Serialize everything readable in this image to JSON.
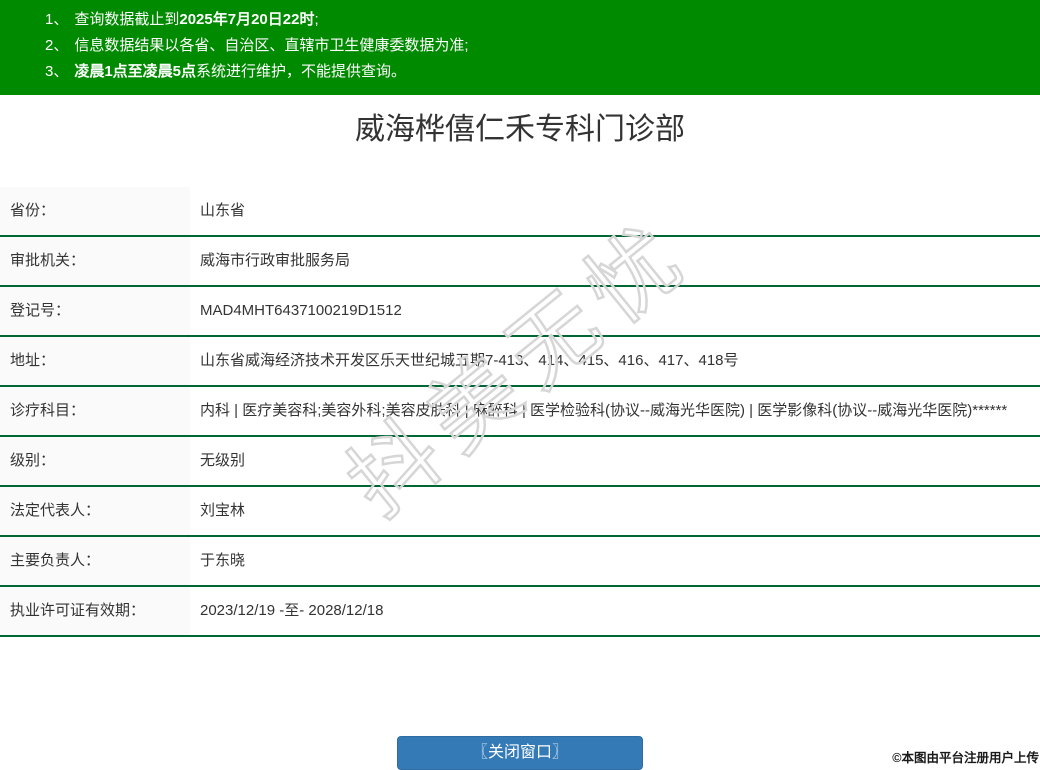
{
  "notice": {
    "line1": {
      "num": "1、",
      "text": "查询数据截止到",
      "bold": "2025年7月20日22时",
      "tail": ";"
    },
    "line2": {
      "num": "2、",
      "text": "信息数据结果以各省、自治区、直辖市卫生健康委数据为准;"
    },
    "line3": {
      "num": "3、",
      "bold": "凌晨1点至凌晨5点",
      "text": "系统进行维护，不能提供查询。"
    }
  },
  "title": "威海桦僖仁禾专科门诊部",
  "table": {
    "rows": [
      {
        "label": "省份：",
        "value": "山东省"
      },
      {
        "label": "审批机关：",
        "value": "威海市行政审批服务局"
      },
      {
        "label": "登记号：",
        "value": "MAD4MHT6437100219D1512"
      },
      {
        "label": "地址：",
        "value": "山东省威海经济技术开发区乐天世纪城五期7-413、414、415、416、417、418号"
      },
      {
        "label": "诊疗科目：",
        "value": "内科 | 医疗美容科;美容外科;美容皮肤科 | 麻醉科 | 医学检验科(协议--威海光华医院) | 医学影像科(协议--威海光华医院)******"
      },
      {
        "label": "级别：",
        "value": "无级别"
      },
      {
        "label": "法定代表人：",
        "value": "刘宝林"
      },
      {
        "label": "主要负责人：",
        "value": "于东晓"
      },
      {
        "label": "执业许可证有效期：",
        "value": "2023/12/19 -至- 2028/12/18"
      }
    ]
  },
  "close_button": {
    "label": "〖关闭窗口〗"
  },
  "watermark": {
    "text": "抖美无忧"
  },
  "copyright": "©本图由平台注册用户上传",
  "colors": {
    "banner_green": "#008a00",
    "separator_green": "#006633",
    "button_blue": "#337ab7",
    "label_bg": "#fafafa",
    "text": "#333333"
  }
}
